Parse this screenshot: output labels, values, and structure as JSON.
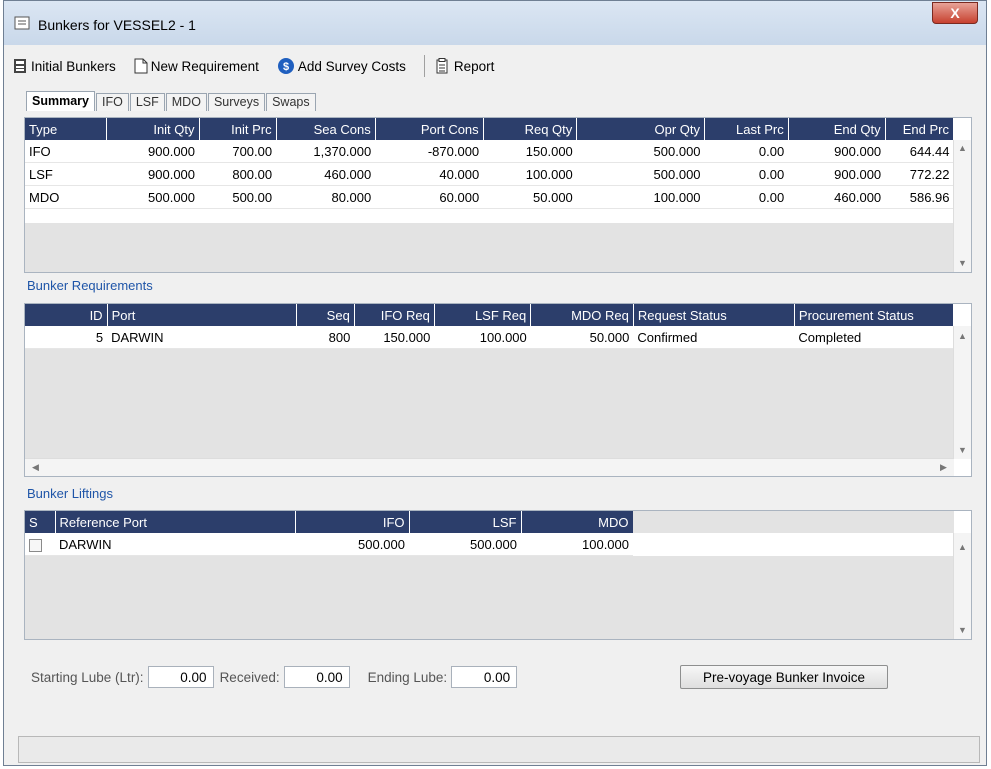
{
  "window": {
    "title": "Bunkers for VESSEL2 - 1",
    "close_label": "X"
  },
  "toolbar": {
    "initial_bunkers": "Initial Bunkers",
    "new_requirement": "New Requirement",
    "add_survey_costs": "Add Survey Costs",
    "report": "Report"
  },
  "tabs": [
    "Summary",
    "IFO",
    "LSF",
    "MDO",
    "Surveys",
    "Swaps"
  ],
  "summary": {
    "columns": [
      "Type",
      "Init Qty",
      "Init Prc",
      "Sea Cons",
      "Port Cons",
      "Req Qty",
      "Opr Qty",
      "Last Prc",
      "End Qty",
      "End Prc"
    ],
    "rows": [
      [
        "IFO",
        "900.000",
        "700.00",
        "1,370.000",
        "-870.000",
        "150.000",
        "500.000",
        "0.00",
        "900.000",
        "644.44"
      ],
      [
        "LSF",
        "900.000",
        "800.00",
        "460.000",
        "40.000",
        "100.000",
        "500.000",
        "0.00",
        "900.000",
        "772.22"
      ],
      [
        "MDO",
        "500.000",
        "500.00",
        "80.000",
        "60.000",
        "50.000",
        "100.000",
        "0.00",
        "460.000",
        "586.96"
      ]
    ]
  },
  "requirements": {
    "label": "Bunker Requirements",
    "columns": [
      "ID",
      "Port",
      "Seq",
      "IFO Req",
      "LSF Req",
      "MDO Req",
      "Request Status",
      "Procurement Status"
    ],
    "rows": [
      [
        "5",
        "DARWIN",
        "800",
        "150.000",
        "100.000",
        "50.000",
        "Confirmed",
        "Completed"
      ]
    ]
  },
  "liftings": {
    "label": "Bunker Liftings",
    "columns": [
      "S",
      "Reference Port",
      "IFO",
      "LSF",
      "MDO"
    ],
    "rows": [
      [
        "",
        "DARWIN",
        "500.000",
        "500.000",
        "100.000"
      ]
    ]
  },
  "lube": {
    "starting_label": "Starting Lube (Ltr):",
    "starting_value": "0.00",
    "received_label": "Received:",
    "received_value": "0.00",
    "ending_label": "Ending Lube:",
    "ending_value": "0.00"
  },
  "invoice_button": "Pre-voyage Bunker Invoice"
}
